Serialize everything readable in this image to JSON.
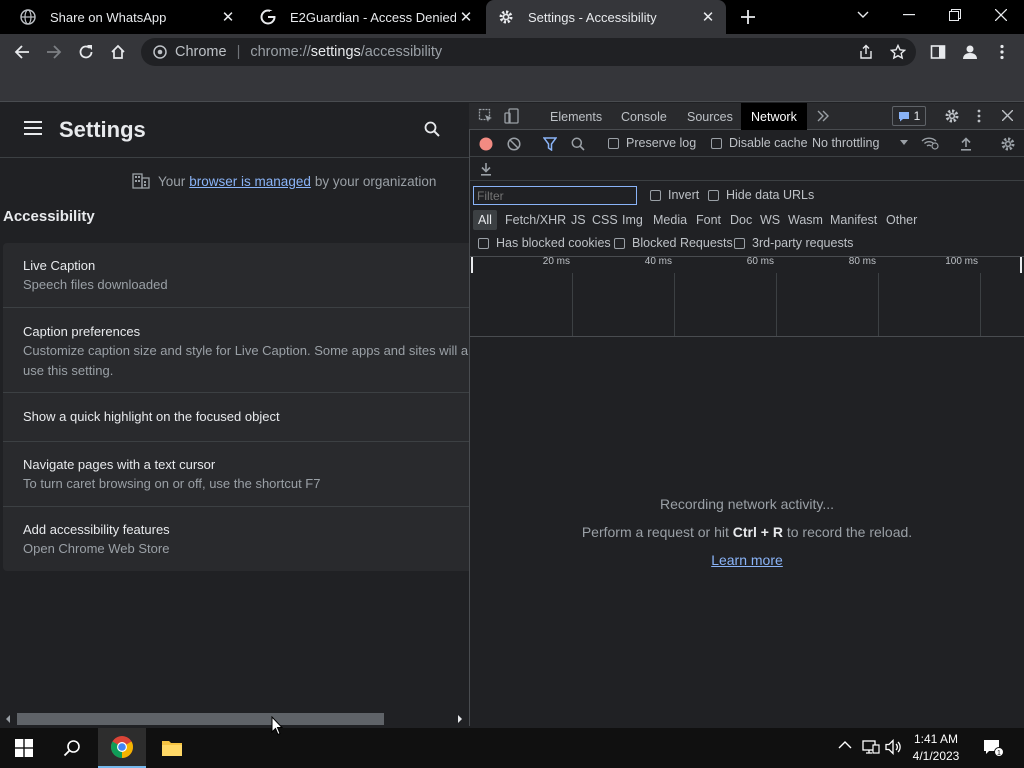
{
  "tabs": [
    {
      "title": "Share on WhatsApp",
      "icon": "globe-icon"
    },
    {
      "title": "E2Guardian - Access Denied",
      "icon": "google-icon"
    },
    {
      "title": "Settings - Accessibility",
      "icon": "gear-icon",
      "active": true
    }
  ],
  "omnibox": {
    "site_label": "Chrome",
    "url_scheme": "chrome://",
    "url_host": "settings",
    "url_path": "/accessibility"
  },
  "settings": {
    "title": "Settings",
    "managed_prefix": "Your",
    "managed_link": "browser is managed",
    "managed_suffix": "by your organization",
    "section_title": "Accessibility",
    "rows": [
      {
        "title": "Live Caption",
        "subtitle": "Speech files downloaded"
      },
      {
        "title": "Caption preferences",
        "subtitle": "Customize caption size and style for Live Caption. Some apps and sites will al",
        "subtitle2": "use this setting."
      },
      {
        "title": "Show a quick highlight on the focused object"
      },
      {
        "title": "Navigate pages with a text cursor",
        "subtitle": "To turn caret browsing on or off, use the shortcut F7"
      },
      {
        "title": "Add accessibility features",
        "subtitle": "Open Chrome Web Store"
      }
    ]
  },
  "devtools": {
    "tabs": [
      "Elements",
      "Console",
      "Sources",
      "Network"
    ],
    "active_tab": "Network",
    "issues_count": "1",
    "preserve_log": "Preserve log",
    "disable_cache": "Disable cache",
    "throttling": "No throttling",
    "filter_placeholder": "Filter",
    "invert": "Invert",
    "hide_data_urls": "Hide data URLs",
    "filter_types": [
      "All",
      "Fetch/XHR",
      "JS",
      "CSS",
      "Img",
      "Media",
      "Font",
      "Doc",
      "WS",
      "Wasm",
      "Manifest",
      "Other"
    ],
    "has_blocked_cookies": "Has blocked cookies",
    "blocked_requests": "Blocked Requests",
    "third_party": "3rd-party requests",
    "ticks": [
      "20 ms",
      "40 ms",
      "60 ms",
      "80 ms",
      "100 ms"
    ],
    "empty_line1": "Recording network activity...",
    "empty_line2_prefix": "Perform a request or hit",
    "empty_line2_keys": "Ctrl + R",
    "empty_line2_suffix": "to record the reload.",
    "learn_more": "Learn more"
  },
  "taskbar": {
    "time": "1:41 AM",
    "date": "4/1/2023"
  },
  "colors": {
    "accent_blue": "#8ab4f8",
    "record_red": "#f28b82",
    "tab_active_bg": "#35363a"
  }
}
